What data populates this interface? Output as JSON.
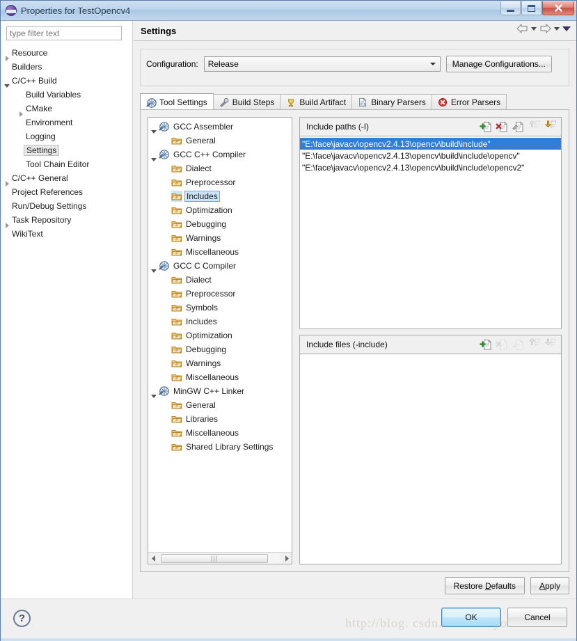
{
  "window": {
    "title": "Properties for TestOpencv4",
    "app_icon": "eclipse-icon",
    "minimize_label": "Minimize",
    "maximize_label": "Maximize",
    "close_label": "Close"
  },
  "filter": {
    "placeholder": "type filter text",
    "value": ""
  },
  "sidebar": {
    "items": [
      {
        "label": "Resource",
        "indent": 0,
        "expander": "collapsed",
        "selected": false
      },
      {
        "label": "Builders",
        "indent": 0,
        "expander": "none",
        "selected": false
      },
      {
        "label": "C/C++ Build",
        "indent": 0,
        "expander": "expanded",
        "selected": false
      },
      {
        "label": "Build Variables",
        "indent": 1,
        "expander": "none",
        "selected": false
      },
      {
        "label": "CMake",
        "indent": 1,
        "expander": "collapsed",
        "selected": false
      },
      {
        "label": "Environment",
        "indent": 1,
        "expander": "none",
        "selected": false
      },
      {
        "label": "Logging",
        "indent": 1,
        "expander": "none",
        "selected": false
      },
      {
        "label": "Settings",
        "indent": 1,
        "expander": "none",
        "selected": true
      },
      {
        "label": "Tool Chain Editor",
        "indent": 1,
        "expander": "none",
        "selected": false
      },
      {
        "label": "C/C++ General",
        "indent": 0,
        "expander": "collapsed",
        "selected": false
      },
      {
        "label": "Project References",
        "indent": 0,
        "expander": "none",
        "selected": false
      },
      {
        "label": "Run/Debug Settings",
        "indent": 0,
        "expander": "none",
        "selected": false
      },
      {
        "label": "Task Repository",
        "indent": 0,
        "expander": "collapsed",
        "selected": false
      },
      {
        "label": "WikiText",
        "indent": 0,
        "expander": "none",
        "selected": false
      }
    ]
  },
  "page": {
    "title": "Settings",
    "nav": {
      "back_icon": "back-arrow-icon",
      "back_menu_icon": "chevron-down-icon",
      "forward_icon": "forward-arrow-icon",
      "forward_menu_icon": "chevron-down-icon",
      "menu_icon": "chevron-down-icon"
    }
  },
  "configuration": {
    "label": "Configuration:",
    "selected": "Release",
    "options": [
      "Release"
    ],
    "manage_button": "Manage Configurations..."
  },
  "tabs": [
    {
      "label": "Tool Settings",
      "icon": "tool-settings-icon",
      "active": true
    },
    {
      "label": "Build Steps",
      "icon": "build-steps-icon",
      "active": false
    },
    {
      "label": "Build Artifact",
      "icon": "build-artifact-icon",
      "active": false
    },
    {
      "label": "Binary Parsers",
      "icon": "binary-parsers-icon",
      "active": false
    },
    {
      "label": "Error Parsers",
      "icon": "error-parsers-icon",
      "active": false
    }
  ],
  "tool_tree": [
    {
      "label": "GCC Assembler",
      "indent": 0,
      "expander": "expanded",
      "icon": "tool-icon",
      "selected": false
    },
    {
      "label": "General",
      "indent": 1,
      "expander": "none",
      "icon": "folder-icon",
      "selected": false
    },
    {
      "label": "GCC C++ Compiler",
      "indent": 0,
      "expander": "expanded",
      "icon": "tool-icon",
      "selected": false
    },
    {
      "label": "Dialect",
      "indent": 1,
      "expander": "none",
      "icon": "folder-icon",
      "selected": false
    },
    {
      "label": "Preprocessor",
      "indent": 1,
      "expander": "none",
      "icon": "folder-icon",
      "selected": false
    },
    {
      "label": "Includes",
      "indent": 1,
      "expander": "none",
      "icon": "folder-icon",
      "selected": true
    },
    {
      "label": "Optimization",
      "indent": 1,
      "expander": "none",
      "icon": "folder-icon",
      "selected": false
    },
    {
      "label": "Debugging",
      "indent": 1,
      "expander": "none",
      "icon": "folder-icon",
      "selected": false
    },
    {
      "label": "Warnings",
      "indent": 1,
      "expander": "none",
      "icon": "folder-icon",
      "selected": false
    },
    {
      "label": "Miscellaneous",
      "indent": 1,
      "expander": "none",
      "icon": "folder-icon",
      "selected": false
    },
    {
      "label": "GCC C Compiler",
      "indent": 0,
      "expander": "expanded",
      "icon": "tool-icon",
      "selected": false
    },
    {
      "label": "Dialect",
      "indent": 1,
      "expander": "none",
      "icon": "folder-icon",
      "selected": false
    },
    {
      "label": "Preprocessor",
      "indent": 1,
      "expander": "none",
      "icon": "folder-icon",
      "selected": false
    },
    {
      "label": "Symbols",
      "indent": 1,
      "expander": "none",
      "icon": "folder-icon",
      "selected": false
    },
    {
      "label": "Includes",
      "indent": 1,
      "expander": "none",
      "icon": "folder-icon",
      "selected": false
    },
    {
      "label": "Optimization",
      "indent": 1,
      "expander": "none",
      "icon": "folder-icon",
      "selected": false
    },
    {
      "label": "Debugging",
      "indent": 1,
      "expander": "none",
      "icon": "folder-icon",
      "selected": false
    },
    {
      "label": "Warnings",
      "indent": 1,
      "expander": "none",
      "icon": "folder-icon",
      "selected": false
    },
    {
      "label": "Miscellaneous",
      "indent": 1,
      "expander": "none",
      "icon": "folder-icon",
      "selected": false
    },
    {
      "label": "MinGW C++ Linker",
      "indent": 0,
      "expander": "expanded",
      "icon": "tool-icon",
      "selected": false
    },
    {
      "label": "General",
      "indent": 1,
      "expander": "none",
      "icon": "folder-icon",
      "selected": false
    },
    {
      "label": "Libraries",
      "indent": 1,
      "expander": "none",
      "icon": "folder-icon",
      "selected": false
    },
    {
      "label": "Miscellaneous",
      "indent": 1,
      "expander": "none",
      "icon": "folder-icon",
      "selected": false
    },
    {
      "label": "Shared Library Settings",
      "indent": 1,
      "expander": "none",
      "icon": "folder-icon",
      "selected": false
    }
  ],
  "include_paths": {
    "title": "Include paths (-I)",
    "toolbar": [
      {
        "name": "add-icon",
        "enabled": true
      },
      {
        "name": "delete-icon",
        "enabled": true
      },
      {
        "name": "edit-icon",
        "enabled": true
      },
      {
        "name": "move-up-icon",
        "enabled": false
      },
      {
        "name": "move-down-icon",
        "enabled": true
      }
    ],
    "rows": [
      {
        "value": "\"E:\\face\\javacv\\opencv2.4.13\\opencv\\build\\include\"",
        "selected": true
      },
      {
        "value": "\"E:\\face\\javacv\\opencv2.4.13\\opencv\\build\\include\\opencv\"",
        "selected": false
      },
      {
        "value": "\"E:\\face\\javacv\\opencv2.4.13\\opencv\\build\\include\\opencv2\"",
        "selected": false
      }
    ]
  },
  "include_files": {
    "title": "Include files (-include)",
    "toolbar": [
      {
        "name": "add-icon",
        "enabled": true
      },
      {
        "name": "delete-icon",
        "enabled": false
      },
      {
        "name": "edit-icon",
        "enabled": false
      },
      {
        "name": "move-up-icon",
        "enabled": false
      },
      {
        "name": "move-down-icon",
        "enabled": false
      }
    ],
    "rows": []
  },
  "panel_buttons": {
    "restore_defaults": "Restore Defaults",
    "restore_defaults_mnemonic": "D",
    "apply": "Apply",
    "apply_mnemonic": "A"
  },
  "footer": {
    "help_icon": "help-icon",
    "ok": "OK",
    "cancel": "Cancel",
    "watermark": "http://blog. csdn. net/StudyofAndroid"
  },
  "colors": {
    "selection_blue": "#2f7fd8",
    "tree_selection": "#cde3f7",
    "close_red": "#cd4f42",
    "primary_button_border": "#3c7fb1"
  }
}
